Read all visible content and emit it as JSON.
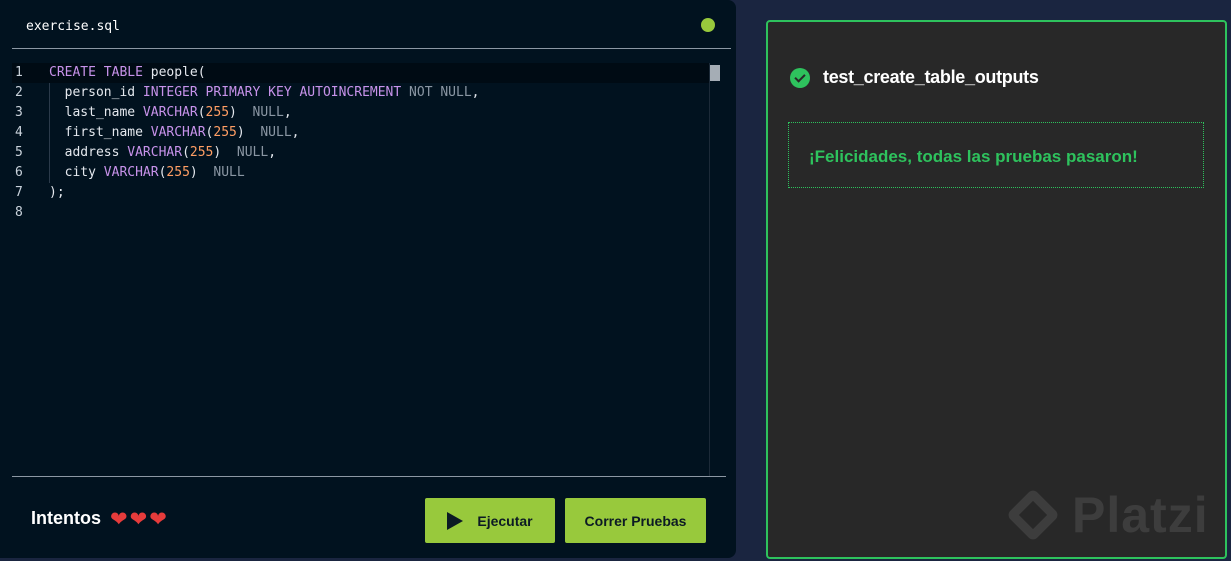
{
  "editor": {
    "file_name": "exercise.sql",
    "lines": [
      {
        "n": "1",
        "tokens": [
          {
            "t": "CREATE",
            "k": "kw"
          },
          {
            "t": " ",
            "k": "txt"
          },
          {
            "t": "TABLE",
            "k": "kw"
          },
          {
            "t": " people(",
            "k": "txt"
          }
        ]
      },
      {
        "n": "2",
        "tokens": [
          {
            "t": "  person_id ",
            "k": "txt"
          },
          {
            "t": "INTEGER",
            "k": "tp"
          },
          {
            "t": " ",
            "k": "txt"
          },
          {
            "t": "PRIMARY KEY",
            "k": "kw"
          },
          {
            "t": " ",
            "k": "txt"
          },
          {
            "t": "AUTOINCREMENT",
            "k": "kw"
          },
          {
            "t": " ",
            "k": "txt"
          },
          {
            "t": "NOT NULL",
            "k": "nul"
          },
          {
            "t": ",",
            "k": "txt"
          }
        ]
      },
      {
        "n": "3",
        "tokens": [
          {
            "t": "  last_name ",
            "k": "txt"
          },
          {
            "t": "VARCHAR",
            "k": "tp"
          },
          {
            "t": "(",
            "k": "txt"
          },
          {
            "t": "255",
            "k": "num"
          },
          {
            "t": ")  ",
            "k": "txt"
          },
          {
            "t": "NULL",
            "k": "nul"
          },
          {
            "t": ",",
            "k": "txt"
          }
        ]
      },
      {
        "n": "4",
        "tokens": [
          {
            "t": "  first_name ",
            "k": "txt"
          },
          {
            "t": "VARCHAR",
            "k": "tp"
          },
          {
            "t": "(",
            "k": "txt"
          },
          {
            "t": "255",
            "k": "num"
          },
          {
            "t": ")  ",
            "k": "txt"
          },
          {
            "t": "NULL",
            "k": "nul"
          },
          {
            "t": ",",
            "k": "txt"
          }
        ]
      },
      {
        "n": "5",
        "tokens": [
          {
            "t": "  address ",
            "k": "txt"
          },
          {
            "t": "VARCHAR",
            "k": "tp"
          },
          {
            "t": "(",
            "k": "txt"
          },
          {
            "t": "255",
            "k": "num"
          },
          {
            "t": ")  ",
            "k": "txt"
          },
          {
            "t": "NULL",
            "k": "nul"
          },
          {
            "t": ",",
            "k": "txt"
          }
        ]
      },
      {
        "n": "6",
        "tokens": [
          {
            "t": "  city ",
            "k": "txt"
          },
          {
            "t": "VARCHAR",
            "k": "tp"
          },
          {
            "t": "(",
            "k": "txt"
          },
          {
            "t": "255",
            "k": "num"
          },
          {
            "t": ")  ",
            "k": "txt"
          },
          {
            "t": "NULL",
            "k": "nul"
          }
        ]
      },
      {
        "n": "7",
        "tokens": [
          {
            "t": ");",
            "k": "txt"
          }
        ]
      },
      {
        "n": "8",
        "tokens": []
      }
    ]
  },
  "footer": {
    "attempts_label": "Intentos",
    "hearts": [
      "❤",
      "❤",
      "❤"
    ],
    "run_label": "Ejecutar",
    "tests_label": "Correr Pruebas"
  },
  "results": {
    "test_name": "test_create_table_outputs",
    "message": "¡Felicidades, todas las pruebas pasaron!",
    "watermark": "Platzi"
  },
  "colors": {
    "accent": "#98c93c",
    "success": "#2ec25d",
    "heart": "#e63b3b"
  }
}
